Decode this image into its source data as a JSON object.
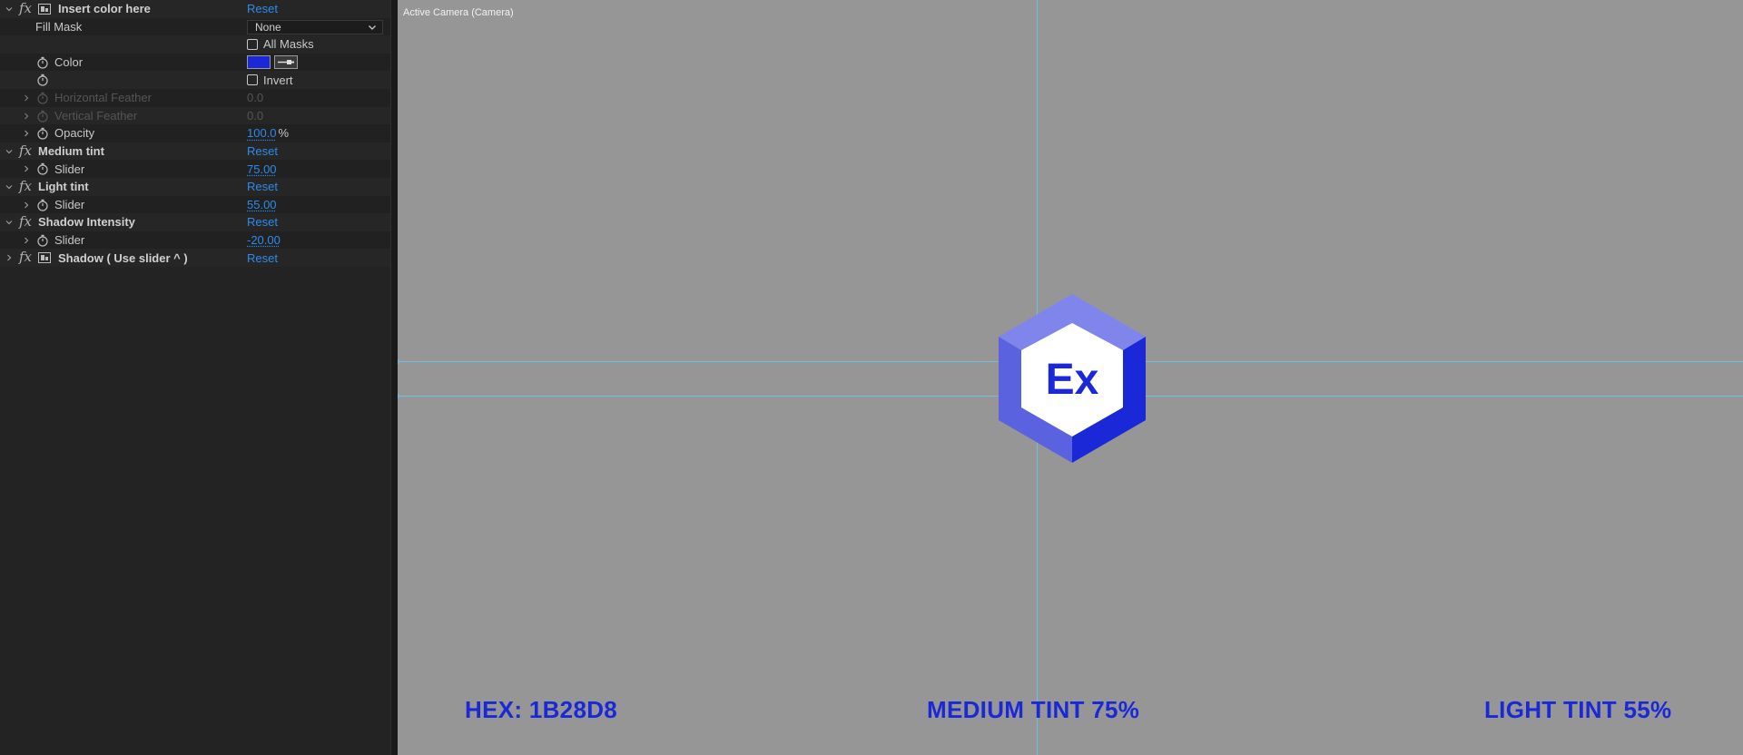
{
  "panel": {
    "effects": [
      {
        "name": "Insert color here",
        "reset": "Reset",
        "fill_mask_label": "Fill Mask",
        "fill_mask_value": "None",
        "all_masks_label": "All Masks",
        "color_label": "Color",
        "color_value": "#1B28D8",
        "invert_label": "Invert",
        "horizontal_feather_label": "Horizontal Feather",
        "horizontal_feather_value": "0.0",
        "vertical_feather_label": "Vertical Feather",
        "vertical_feather_value": "0.0",
        "opacity_label": "Opacity",
        "opacity_value": "100.0",
        "opacity_unit": "%"
      },
      {
        "name": "Medium tint",
        "reset": "Reset",
        "slider_label": "Slider",
        "slider_value": "75.00"
      },
      {
        "name": "Light tint",
        "reset": "Reset",
        "slider_label": "Slider",
        "slider_value": "55.00"
      },
      {
        "name": "Shadow Intensity",
        "reset": "Reset",
        "slider_label": "Slider",
        "slider_value": "-20.00"
      },
      {
        "name": "Shadow ( Use slider ^ )",
        "reset": "Reset"
      }
    ]
  },
  "viewer": {
    "camera_label": "Active Camera (Camera)",
    "logo_text": "Ex",
    "captions": {
      "hex": "HEX: 1B28D8",
      "medium": "MEDIUM TINT 75%",
      "light": "LIGHT TINT 55%"
    },
    "colors": {
      "base": "#1B28D8",
      "medium_tint": "#5A62E0",
      "light_tint": "#8085EC",
      "background": "#969696",
      "guide": "#6FC0DD"
    }
  }
}
